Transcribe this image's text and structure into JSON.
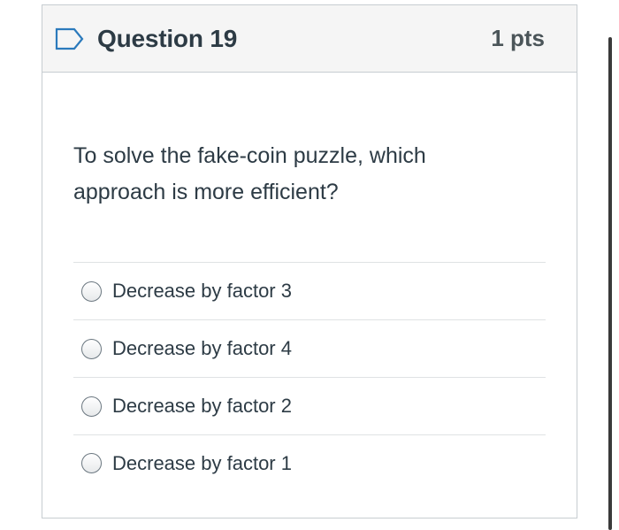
{
  "question": {
    "title": "Question 19",
    "points": "1 pts",
    "flag_icon": "flag-outline-icon",
    "accent_color": "#1a73e8",
    "text": "To solve the fake-coin puzzle, which approach is more efficient?"
  },
  "answers": [
    {
      "label": "Decrease by factor 3",
      "selected": false
    },
    {
      "label": "Decrease by factor 4",
      "selected": false
    },
    {
      "label": "Decrease by factor 2",
      "selected": false
    },
    {
      "label": "Decrease by factor 1",
      "selected": false
    }
  ]
}
